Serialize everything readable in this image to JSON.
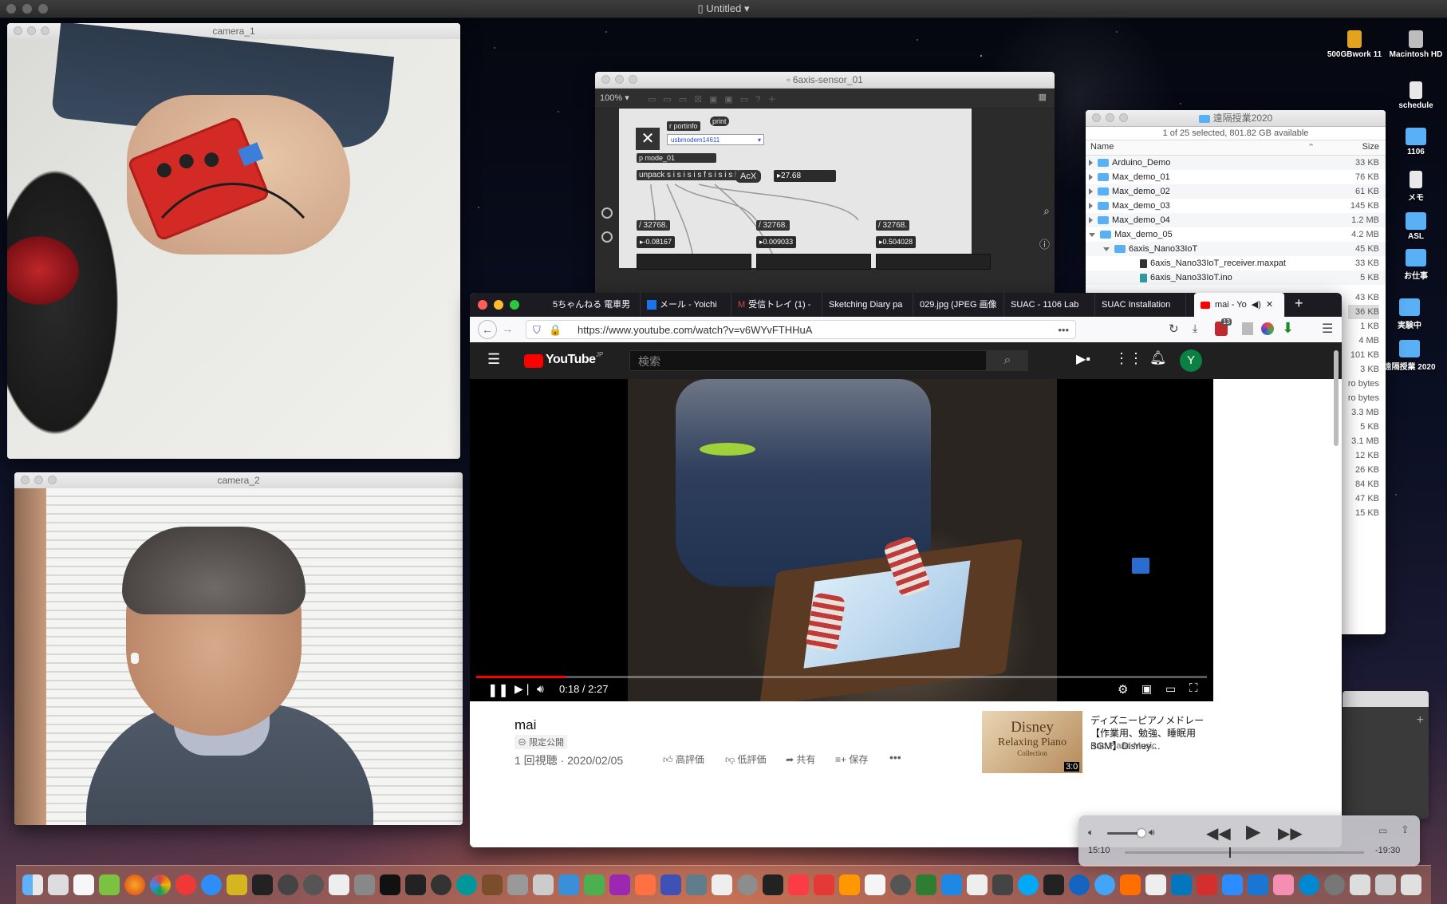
{
  "menubar": {
    "title": "Untitled"
  },
  "camera1": {
    "title": "camera_1"
  },
  "camera2": {
    "title": "camera_2"
  },
  "max": {
    "title": "6axis-sensor_01",
    "zoom": "100%",
    "objects": {
      "rportinfo": "r portinfo",
      "print": "print",
      "port": "usbmodem14611",
      "pmode": "p mode_01",
      "unpack": "unpack s i s i s i s f s i s i s i",
      "acx": "AcX",
      "acx_value": "27.68",
      "div1": "/ 32768.",
      "div2": "/ 32768.",
      "div3": "/ 32768.",
      "num1": "-0.08167",
      "num2": "0.009033",
      "num3": "0.504028"
    }
  },
  "finder": {
    "title": "遠隔授業2020",
    "status": "1 of 25 selected, 801.82 GB available",
    "col_name": "Name",
    "col_size": "Size",
    "rows": [
      {
        "name": "Arduino_Demo",
        "size": "33 KB"
      },
      {
        "name": "Max_demo_01",
        "size": "76 KB"
      },
      {
        "name": "Max_demo_02",
        "size": "61 KB"
      },
      {
        "name": "Max_demo_03",
        "size": "145 KB"
      },
      {
        "name": "Max_demo_04",
        "size": "1.2 MB"
      },
      {
        "name": "Max_demo_05",
        "size": "4.2 MB"
      },
      {
        "name": "6axis_Nano33IoT",
        "size": "45 KB"
      },
      {
        "name": "6axis_Nano33IoT_receiver.maxpat",
        "size": "33 KB"
      },
      {
        "name": "6axis_Nano33IoT.ino",
        "size": "5 KB"
      }
    ],
    "hidden_sizes": [
      "43 KB",
      "36 KB",
      "1 KB",
      "4 MB",
      "101 KB",
      "3 KB",
      "ro bytes",
      "ro bytes",
      "3.3 MB",
      "5 KB",
      "3.1 MB",
      "12 KB",
      "26 KB",
      "84 KB",
      "47 KB",
      "15 KB"
    ]
  },
  "browser": {
    "tabs": [
      {
        "label": "5ちゃんねる 電車男"
      },
      {
        "label": "メール - Yoichi"
      },
      {
        "label": "受信トレイ (1) -"
      },
      {
        "label": "Sketching Diary pa"
      },
      {
        "label": "029.jpg (JPEG 画像"
      },
      {
        "label": "SUAC - 1106 Lab"
      },
      {
        "label": "SUAC Installation"
      },
      {
        "label": "mai - Yo"
      }
    ],
    "url": "https://www.youtube.com/watch?v=v6WYvFTHHuA",
    "badge_count": "13"
  },
  "youtube": {
    "logo": "YouTube",
    "logo_region": "JP",
    "search_placeholder": "検索",
    "avatar_letter": "Y",
    "time": "0:18 / 2:27",
    "progress": 0.122,
    "video_title": "mai",
    "visibility": "限定公開",
    "meta": "1 回視聴 · 2020/02/05",
    "like": "高評価",
    "dislike": "低評価",
    "share": "共有",
    "save": "保存",
    "suggest_title": "ディズニーピアノメドレー【作業用、勉強、睡眠用BGM】Disney…",
    "suggest_channel": "Kno Piano Music",
    "thumb_text1": "Disney",
    "thumb_text2": "Relaxing Piano",
    "thumb_text3": "Collection",
    "thumb_time": "3:0"
  },
  "miniplayer": {
    "elapsed": "15:10",
    "remaining": "-19:30",
    "progress": 0.437
  },
  "desktop": {
    "icons": [
      {
        "label": "500GBwork 11"
      },
      {
        "label": "Macintosh HD"
      },
      {
        "label": "schedule"
      },
      {
        "label": "1106"
      },
      {
        "label": "メモ"
      },
      {
        "label": "ASL"
      },
      {
        "label": "お仕事"
      },
      {
        "label": "実験中"
      },
      {
        "label": "遠隔授業 2020"
      }
    ]
  },
  "colors": {
    "youtube_red": "#ff0000",
    "folder_blue": "#5ab0f4",
    "max_bg": "#2b2b2b"
  }
}
